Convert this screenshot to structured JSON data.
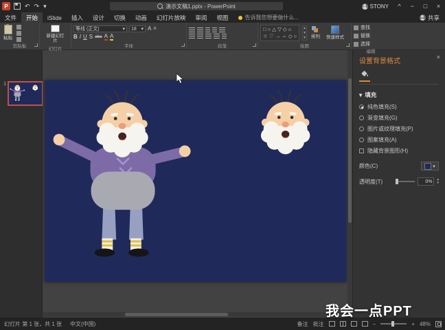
{
  "colors": {
    "titlebar_bg": "#252526",
    "ribbon_bg": "#3b3b3b",
    "canvas_bg": "#424242",
    "panel_bg": "#2e2e2e",
    "pane_bg": "#333333",
    "status_bg": "#232323",
    "slide_bg": "#1f2a5b",
    "accent": "#d88d3e",
    "thumb_border": "#c0504d",
    "text_main": "#d6d6d6",
    "skin": "#f5cfa6",
    "beard": "#f6f4ee",
    "hair": "#3a332c",
    "sweater": "#7d6ba8",
    "sweater_lt": "#a795cf",
    "graybody": "#a9a9b1",
    "pants": "#98a0c2",
    "sock": "#f3efe6",
    "stripe": "#e3bf3e",
    "shoe": "#151517",
    "nose": "#e99f78",
    "mouth": "#452420",
    "lip": "#c2574a"
  },
  "glyphs": {
    "dropdown": "▾",
    "up": "▴",
    "down": "▾",
    "minus": "−",
    "plus": "+",
    "a_letter": "A",
    "ribbon_collapse": "^"
  },
  "titlebar": {
    "document_title": "演示文稿1.pptx - PowerPoint",
    "user_name": "STONY",
    "undo_glyph": "↶",
    "redo_glyph": "↷",
    "minimize_glyph": "−",
    "maximize_glyph": "□",
    "close_glyph": "×"
  },
  "ribbon": {
    "tabs": [
      "文件",
      "开始",
      "iSlide",
      "插入",
      "设计",
      "切换",
      "动画",
      "幻灯片放映",
      "审阅",
      "视图"
    ],
    "tell_me": "告诉我您想要做什么...",
    "share_label": "共享",
    "clipboard_label": "剪贴板",
    "paste_label": "粘贴",
    "slides_label": "幻灯片",
    "new_slide_label": "新建幻灯片",
    "font_label": "字体",
    "font_name": "等线 (正文)",
    "font_size": "18",
    "bold": "B",
    "italic": "I",
    "underline": "U",
    "shadow": "S",
    "strike": "abc",
    "paragraph_label": "段落",
    "drawing_label": "绘图",
    "shapes_row1": "□ ○ △ ▽ ◇ ⌂",
    "shapes_row2": "☆ ♡ → ⇔ ◇ ○",
    "arrange_label": "排列",
    "quick_styles_label": "快速样式",
    "editing_label": "编辑",
    "find_label": "查找",
    "replace_label": "替换",
    "select_label": "选择"
  },
  "thumbnails": {
    "slide_number": "1"
  },
  "pane": {
    "title": "设置背景格式",
    "close_glyph": "×",
    "fill_section": "填充",
    "options": [
      "纯色填充(S)",
      "渐变填充(G)",
      "图片或纹理填充(P)",
      "图案填充(A)",
      "隐藏背景图形(H)"
    ],
    "color_label": "颜色(C)",
    "transparency_label": "透明度(T)",
    "transparency_value": "0%"
  },
  "statusbar": {
    "slide_indicator": "幻灯片 第 1 张，共 1 张",
    "language": "中文(中国)",
    "notes_label": "备注",
    "comments_label": "批注",
    "zoom_value": "48%"
  },
  "watermark": "我会一点PPT"
}
